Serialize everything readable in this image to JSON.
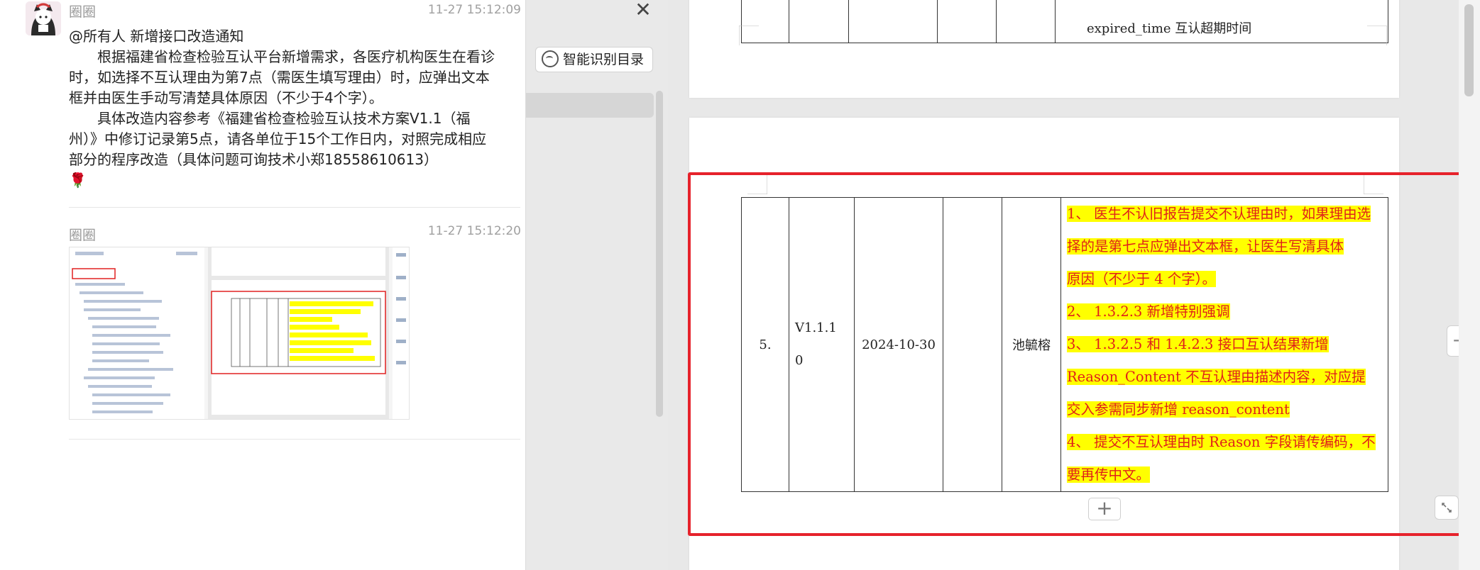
{
  "chat": {
    "messages": [
      {
        "sender": "圈圈",
        "time": "11-27 15:12:09",
        "mention_line": "@所有人   新增接口改造通知",
        "para1": "根据福建省检查检验互认平台新增需求，各医疗机构医生在看诊时，如选择不互认理由为第7点（需医生填写理由）时，应弹出文本框并由医生手动写清楚具体原因（不少于4个字）。",
        "para2": "具体改造内容参考《福建省检查检验互认技术方案V1.1（福州）》中修订记录第5点，请各单位于15个工作日内，对照完成相应部分的程序改造（具体问题可询技术小郑18558610613）",
        "emoji": "🌹"
      },
      {
        "sender": "圈圈",
        "time": "11-27 15:12:20",
        "attachment": "screenshot-image"
      }
    ]
  },
  "toc": {
    "close_icon": "close-icon",
    "smart_button_label": "智能识别目录"
  },
  "document": {
    "top_table_last_row": {
      "text": "expired_time 互认超期时间"
    },
    "revision_row": {
      "number": "5.",
      "version_line1": "V1.1.1",
      "version_line2": "0",
      "date": "2024-10-30",
      "author": "池毓榕",
      "changes": [
        "1、 医生不认旧报告提交不认理由时，如果理由选",
        "择的是第七点应弹出文本框，让医生写清具体",
        "原因（不少于 4 个字）。",
        "2、 1.3.2.3 新增特别强调",
        "3、 1.3.2.5 和 1.4.2.3 接口互认结果新增",
        "Reason_Content 不互认理由描述内容，对应提",
        "交入参需同步新增 reason_content",
        "4、 提交不互认理由时 Reason 字段请传编码，不",
        "要再传中文。"
      ]
    },
    "add_row_symbol": "+",
    "add_col_symbol": "+",
    "highlight_color": "#ffff00",
    "text_color": "#e0201a",
    "annotation_color": "#e6222b"
  }
}
